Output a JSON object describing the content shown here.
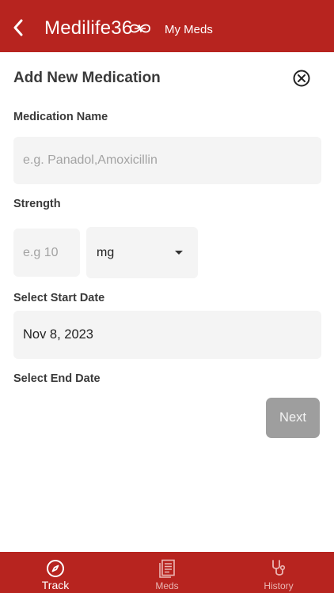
{
  "header": {
    "app_name": "Medilife36",
    "subtitle": "My Meds",
    "background": "#b7241f",
    "back_icon": "chevron-left-icon",
    "logo_icon": "heartbeat-infinity-icon"
  },
  "form": {
    "title": "Add New Medication",
    "close_icon": "close-circle-icon",
    "medication_name": {
      "label": "Medication Name",
      "placeholder": "e.g. Panadol,Amoxicillin",
      "value": ""
    },
    "strength": {
      "label": "Strength",
      "placeholder": "e.g 10",
      "value": "",
      "unit": "mg",
      "unit_icon": "caret-down-icon"
    },
    "start_date": {
      "label": "Select Start Date",
      "value": "Nov 8, 2023"
    },
    "end_date": {
      "label": "Select End Date"
    },
    "next_label": "Next",
    "next_color": "#9e9e9e"
  },
  "tabbar": {
    "background": "#b7241f",
    "tabs": [
      {
        "label": "Track",
        "icon": "compass-icon",
        "active": true
      },
      {
        "label": "Meds",
        "icon": "document-list-icon",
        "active": false
      },
      {
        "label": "History",
        "icon": "stethoscope-icon",
        "active": false
      }
    ]
  }
}
